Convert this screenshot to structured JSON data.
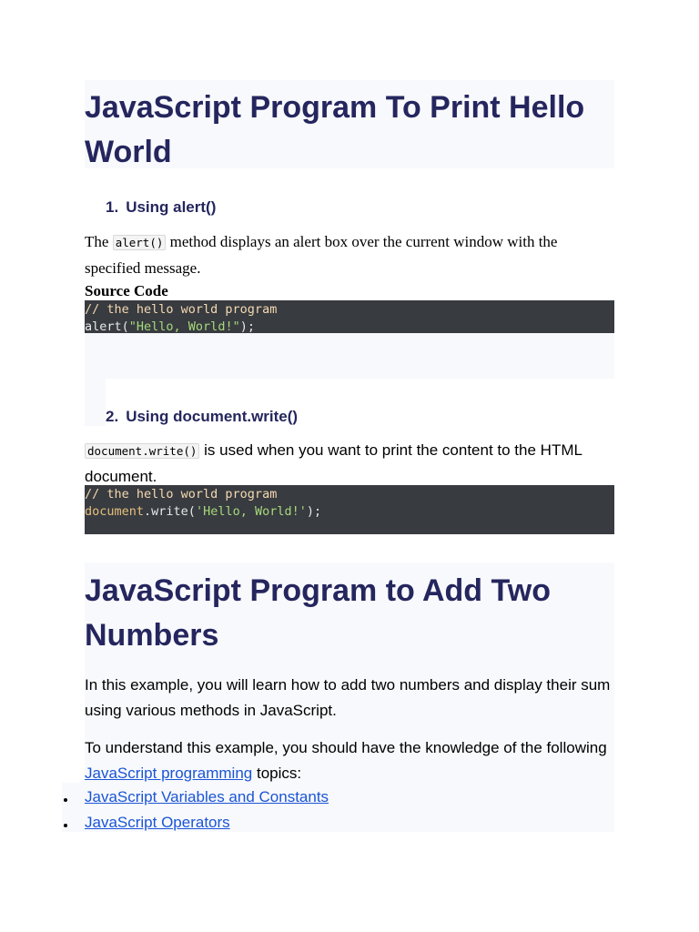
{
  "section1": {
    "title": "JavaScript Program To Print Hello World",
    "method1": {
      "number": "1.",
      "label": "Using alert()",
      "desc_before": "The",
      "desc_code": "alert()",
      "desc_after": "method displays an alert box over the current window with the specified message.",
      "source_label": "Source Code",
      "code_comment": "// the hello world program",
      "code_fn": "alert(",
      "code_string": "\"Hello, World!\"",
      "code_end": ");"
    },
    "method2": {
      "number": "2.",
      "label": "Using document.write()",
      "desc_code": "document.write()",
      "desc_after": "is used when you want to print the content to the HTML document.",
      "code_comment": "// the hello world program",
      "code_obj": "document",
      "code_fn": ".write(",
      "code_string": "'Hello, World!'",
      "code_end": ");"
    }
  },
  "section2": {
    "title": "JavaScript Program to Add Two Numbers",
    "intro": "In this example, you will learn how to add two numbers and display their sum using various methods in JavaScript.",
    "prereq_before": "To understand this example, you should have the knowledge of the following",
    "prereq_link": "JavaScript programming",
    "prereq_after": "topics:",
    "topics": [
      "JavaScript Variables and Constants",
      "JavaScript Operators"
    ]
  },
  "colors": {
    "heading": "#25265e",
    "link": "#1a55d6",
    "code_bg": "#383b40",
    "panel_bg": "#f8f9fc"
  }
}
